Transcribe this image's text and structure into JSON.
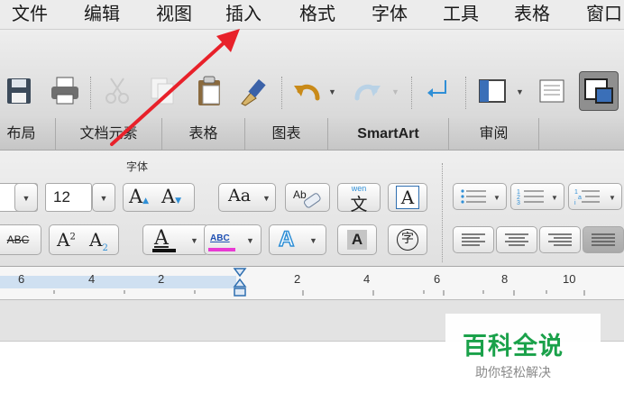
{
  "menu": {
    "items": [
      "文件",
      "编辑",
      "视图",
      "插入",
      "格式",
      "字体",
      "工具",
      "表格",
      "窗口"
    ]
  },
  "ribbon_tabs": [
    "布局",
    "文档元素",
    "表格",
    "图表",
    "SmartArt",
    "审阅"
  ],
  "font_group": {
    "title": "字体",
    "font_size": "12",
    "pinyin_label": "wen",
    "pinyin_char": "文",
    "strike_label": "ABC",
    "highlight_label": "ABC",
    "enclose_char": "字"
  },
  "ruler": {
    "labels": [
      "6",
      "4",
      "2",
      "2",
      "4",
      "6",
      "8",
      "10"
    ]
  },
  "watermark": {
    "title": "百科全说",
    "subtitle": "助你轻松解决"
  },
  "colors": {
    "annotation_arrow": "#e8212a",
    "watermark_green": "#1aa14a",
    "highlight_magenta": "#e83ad3",
    "accent_blue": "#2f8fd6"
  }
}
